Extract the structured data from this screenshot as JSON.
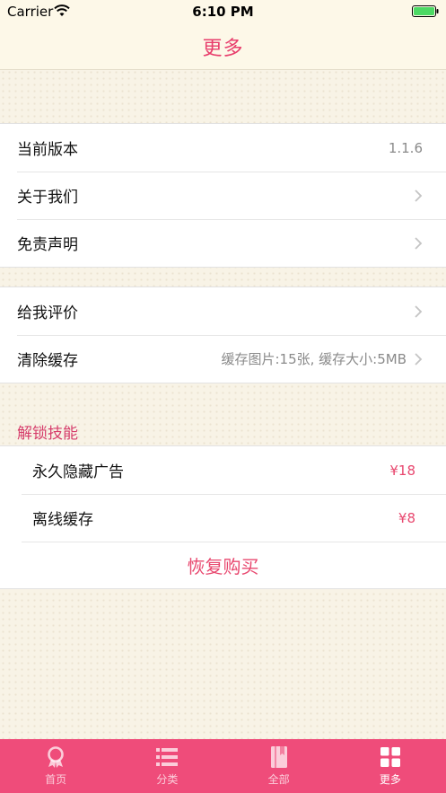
{
  "status_bar": {
    "carrier": "Carrier",
    "time": "6:10 PM"
  },
  "nav": {
    "title": "更多"
  },
  "group_info": [
    {
      "label": "当前版本",
      "value": "1.1.6",
      "chevron": false
    },
    {
      "label": "关于我们",
      "value": "",
      "chevron": true
    },
    {
      "label": "免责声明",
      "value": "",
      "chevron": true
    }
  ],
  "group_tools": [
    {
      "label": "给我评价",
      "value": "",
      "chevron": true
    },
    {
      "label": "清除缓存",
      "value": "缓存图片:15张, 缓存大小:5MB",
      "chevron": true
    }
  ],
  "unlock": {
    "header": "解锁技能",
    "items": [
      {
        "label": "永久隐藏广告",
        "price": "¥18"
      },
      {
        "label": "离线缓存",
        "price": "¥8"
      }
    ],
    "restore_label": "恢复购买"
  },
  "tabbar": {
    "items": [
      {
        "label": "首页",
        "icon": "award-icon",
        "active": false
      },
      {
        "label": "分类",
        "icon": "list-icon",
        "active": false
      },
      {
        "label": "全部",
        "icon": "book-icon",
        "active": false
      },
      {
        "label": "更多",
        "icon": "grid-icon",
        "active": true
      }
    ]
  },
  "colors": {
    "accent": "#e83e6c",
    "tabbar": "#ef4c7a",
    "background": "#f8f3e6"
  }
}
